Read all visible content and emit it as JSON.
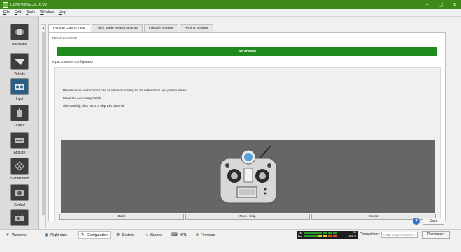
{
  "window": {
    "title": "LibrePilot GCS 16.09",
    "controls": {
      "minimize": "–",
      "maximize": "▢",
      "close": "✕"
    }
  },
  "menu": [
    "File",
    "Edit",
    "Tools",
    "Window",
    "Help"
  ],
  "sidebar": {
    "items": [
      {
        "label": "Hardware",
        "icon": "hardware-chip-icon"
      },
      {
        "label": "Vehicle",
        "icon": "vehicle-icon"
      },
      {
        "label": "Input",
        "icon": "input-transmitter-icon",
        "active": true
      },
      {
        "label": "Output",
        "icon": "output-motor-icon"
      },
      {
        "label": "Attitude",
        "icon": "attitude-icon"
      },
      {
        "label": "Stabilization",
        "icon": "stabilization-icon"
      },
      {
        "label": "Gimbal",
        "icon": "gimbal-camera-icon"
      }
    ]
  },
  "tabs": [
    "Remote Control Input",
    "Flight Mode Switch Settings",
    "Failsafe Settings",
    "Arming Settings"
  ],
  "receiver": {
    "section_label": "Receiver Activity",
    "status": "No activity",
    "status_color": "#1f8b1f"
  },
  "config": {
    "section_label": "Input Channel Configuration",
    "instructions": [
      "Please move each control one at a time according to the instructions and picture below.",
      "Move the Accessory0 stick.",
      "Alternatively, click Next to skip this channel."
    ]
  },
  "buttons": {
    "back": "Back",
    "next": "Next / Skip",
    "cancel": "Cancel"
  },
  "footer": {
    "help": "?",
    "save": "Save"
  },
  "bottom_tabs": [
    {
      "label": "Welcome",
      "icon": "welcome-icon"
    },
    {
      "label": "Flight data",
      "icon": "flight-data-icon"
    },
    {
      "label": "Configuration",
      "icon": "configuration-icon",
      "active": true
    },
    {
      "label": "System",
      "icon": "system-icon"
    },
    {
      "label": "Scopes",
      "icon": "scopes-icon"
    },
    {
      "label": "HITL",
      "icon": "hitl-icon"
    },
    {
      "label": "Firmware",
      "icon": "firmware-icon"
    }
  ],
  "telemetry": {
    "tx_label": "Tx",
    "rx_label": "Rx",
    "tx_value": "36",
    "rx_value": "1159.75"
  },
  "connection": {
    "label": "Connections:",
    "selected": "USB: CopterControl",
    "disconnect": "Disconnect"
  }
}
